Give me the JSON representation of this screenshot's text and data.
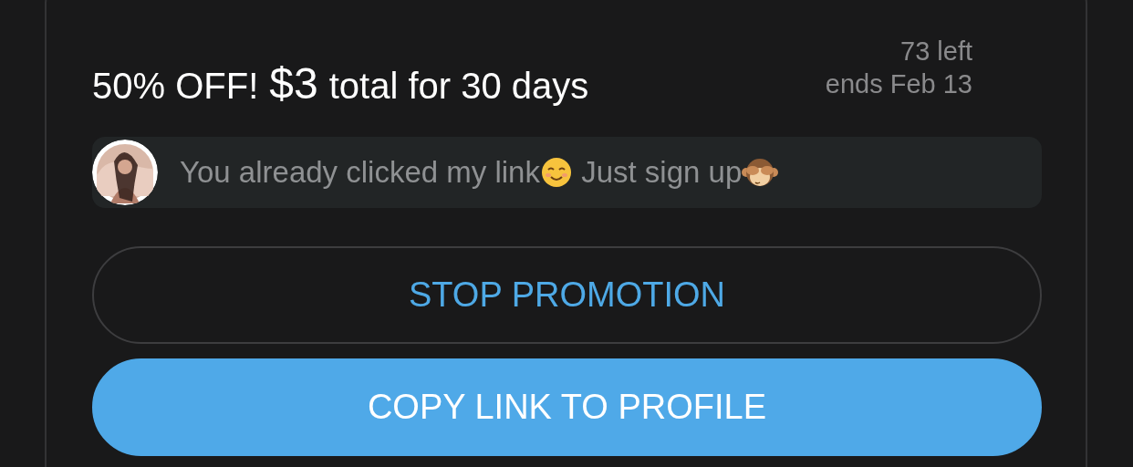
{
  "promo": {
    "title": {
      "prefix": "50% OFF!",
      "price": "$3",
      "suffix": "total for 30 days"
    },
    "remaining": "73 left",
    "ends": "ends Feb 13",
    "message": {
      "parts": [
        {
          "kind": "text",
          "text": "You already clicked my link"
        },
        {
          "kind": "smile"
        },
        {
          "kind": "text",
          "text": " Just sign up"
        },
        {
          "kind": "monkey"
        }
      ]
    },
    "buttons": [
      {
        "kind": "outline",
        "label": "STOP PROMOTION"
      },
      {
        "kind": "filled",
        "label": "COPY LINK TO PROFILE"
      }
    ]
  }
}
